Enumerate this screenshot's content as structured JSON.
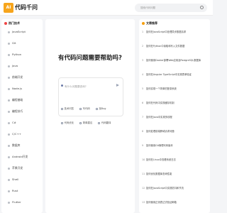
{
  "header": {
    "logo_text": "AI",
    "brand": "代码千问",
    "search_placeholder": "搜索代码问题"
  },
  "sidebar": {
    "heading": "热门技术",
    "items": [
      "JavaScript",
      "Git",
      "Python",
      "Java",
      "前端开发",
      "Node.js",
      "编程基础",
      "编程技巧",
      "C#",
      "C/C++",
      "数据库",
      "Android开发",
      "苹果开发",
      "Shell",
      "Rust",
      "Flutter"
    ]
  },
  "main": {
    "title": "有代码问题需要帮助吗?",
    "ask_placeholder": "有什么问题要咨询?",
    "chips": [
      "技术问答",
      "写代码",
      "找Bug",
      "代码优化",
      "简单建议",
      "代码翻译"
    ]
  },
  "articles": {
    "heading": "文章推荐",
    "items": [
      "如何在JavaScript中处理异步数据请求",
      "如何在Python中读取和写入文件数据",
      "如何使用Docker部署Web应用及PostgreSQL数据库",
      "如何在Angular TypeScript中实现表单验证",
      "如何实现一个简单的登录系统",
      "如何在代码中实现缓存机制",
      "如何在Java中实现多线程",
      "如何处理前端跨域请求问题",
      "如何使用Git管理代码版本",
      "如何在Linux中查看系统日志",
      "如何优化数据库查询性能",
      "如何在JavaScript中实现防抖和节流",
      "如何使用正则表达式验证邮箱"
    ]
  },
  "colors": {
    "logo": "#f7a51c",
    "accent": "#ef4444"
  }
}
